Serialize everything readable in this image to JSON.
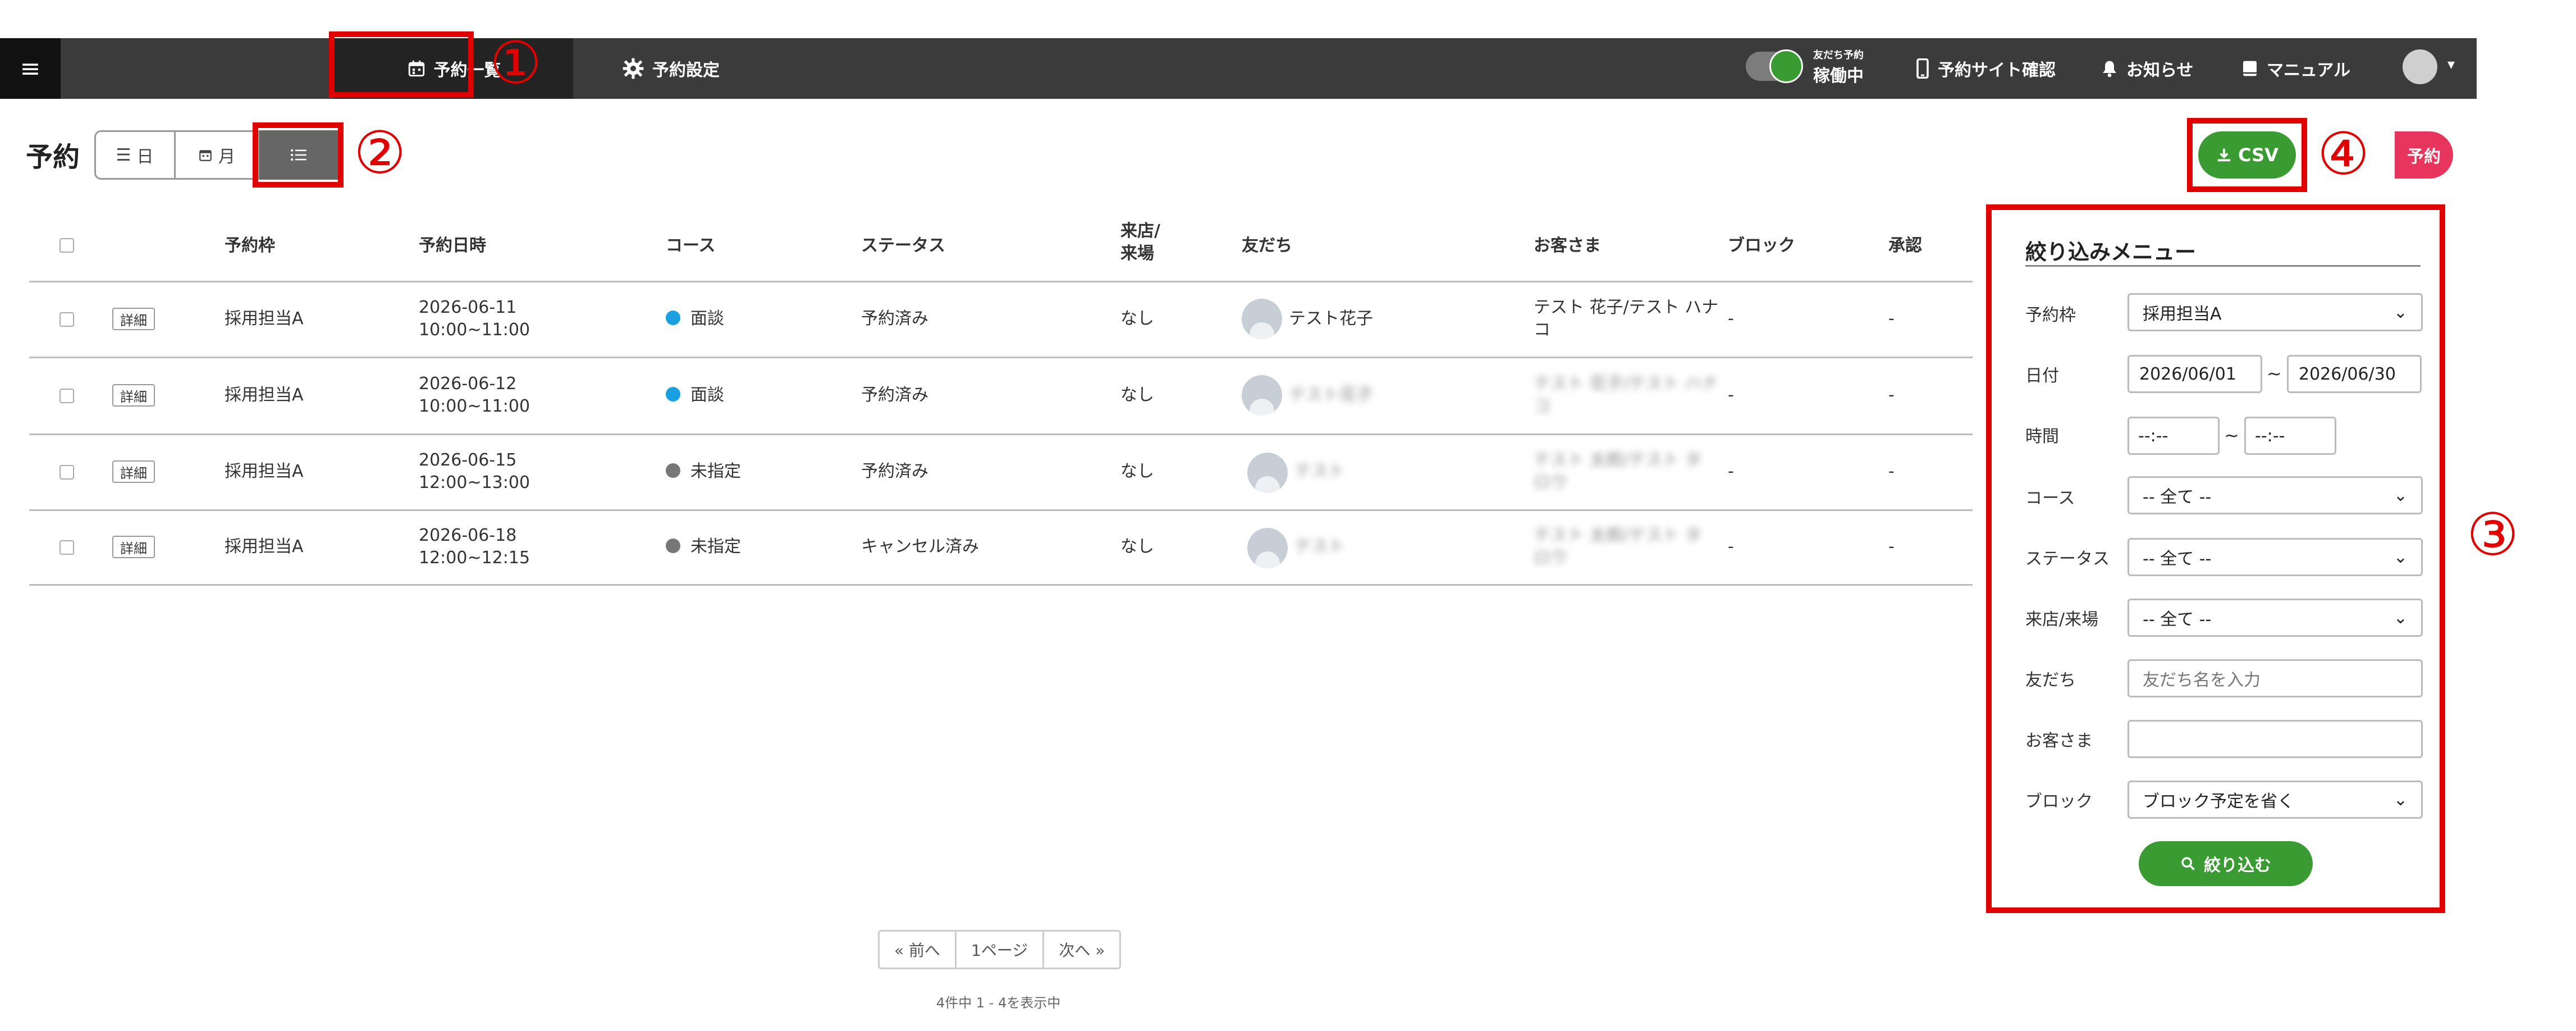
{
  "topbar": {
    "menu_glyph": "≡",
    "nav_list_label": "予約一覧",
    "nav_settings_label": "予約設定",
    "toggle_caption": "友だち予約",
    "toggle_status": "稼働中",
    "site_check_label": "予約サイト確認",
    "news_label": "お知らせ",
    "manual_label": "マニュアル"
  },
  "annotations": {
    "n1": "①",
    "n2": "②",
    "n3": "③",
    "n4": "④"
  },
  "page": {
    "title": "予約"
  },
  "view_switch": {
    "day": "日",
    "month": "月"
  },
  "actions": {
    "csv_label": "CSV",
    "reserve_label": "予約"
  },
  "table": {
    "headers": {
      "frame": "予約枠",
      "datetime": "予約日時",
      "course": "コース",
      "status": "ステータス",
      "visit": "来店/\n来場",
      "friend": "友だち",
      "customer": "お客さま",
      "block": "ブロック",
      "approve": "承認"
    },
    "detail_label": "詳細",
    "rows": [
      {
        "frame": "採用担当A",
        "date": "2026-06-11",
        "time": "10:00~11:00",
        "course": "面談",
        "course_color": "#1a9fe0",
        "status": "予約済み",
        "visit": "なし",
        "friend": "テスト花子",
        "customer": "テスト 花子/テスト ハナ\nコ",
        "block": "-",
        "approve": "-"
      },
      {
        "frame": "採用担当A",
        "date": "2026-06-12",
        "time": "10:00~11:00",
        "course": "面談",
        "course_color": "#1a9fe0",
        "status": "予約済み",
        "visit": "なし",
        "friend": "テスト花子",
        "customer": "テスト 花子/テスト ハナ\nコ",
        "block": "-",
        "approve": "-"
      },
      {
        "frame": "採用担当A",
        "date": "2026-06-15",
        "time": "12:00~13:00",
        "course": "未指定",
        "course_color": "#777777",
        "status": "予約済み",
        "visit": "なし",
        "friend": "テスト",
        "customer": "テスト 太郎/テスト タ\nロウ",
        "block": "-",
        "approve": "-"
      },
      {
        "frame": "採用担当A",
        "date": "2026-06-18",
        "time": "12:00~12:15",
        "course": "未指定",
        "course_color": "#777777",
        "status": "キャンセル済み",
        "visit": "なし",
        "friend": "テスト",
        "customer": "テスト 太郎/テスト タ\nロウ",
        "block": "-",
        "approve": "-"
      }
    ]
  },
  "pagination": {
    "prev": "« 前へ",
    "page": "1ページ",
    "next": "次へ »",
    "info": "4件中 1 - 4を表示中"
  },
  "filter": {
    "title": "絞り込みメニュー",
    "frame_label": "予約枠",
    "frame_value": "採用担当A",
    "date_label": "日付",
    "date_from": "2026/06/01",
    "date_to": "2026/06/30",
    "time_label": "時間",
    "time_from": "--:--",
    "time_to": "--:--",
    "tilde": "~",
    "course_label": "コース",
    "course_value": "-- 全て --",
    "status_label": "ステータス",
    "status_value": "-- 全て --",
    "visit_label": "来店/来場",
    "visit_value": "-- 全て --",
    "friend_label": "友だち",
    "friend_placeholder": "友だち名を入力",
    "customer_label": "お客さま",
    "customer_value": "",
    "block_label": "ブロック",
    "block_value": "ブロック予定を省く",
    "submit_label": "絞り込む"
  }
}
